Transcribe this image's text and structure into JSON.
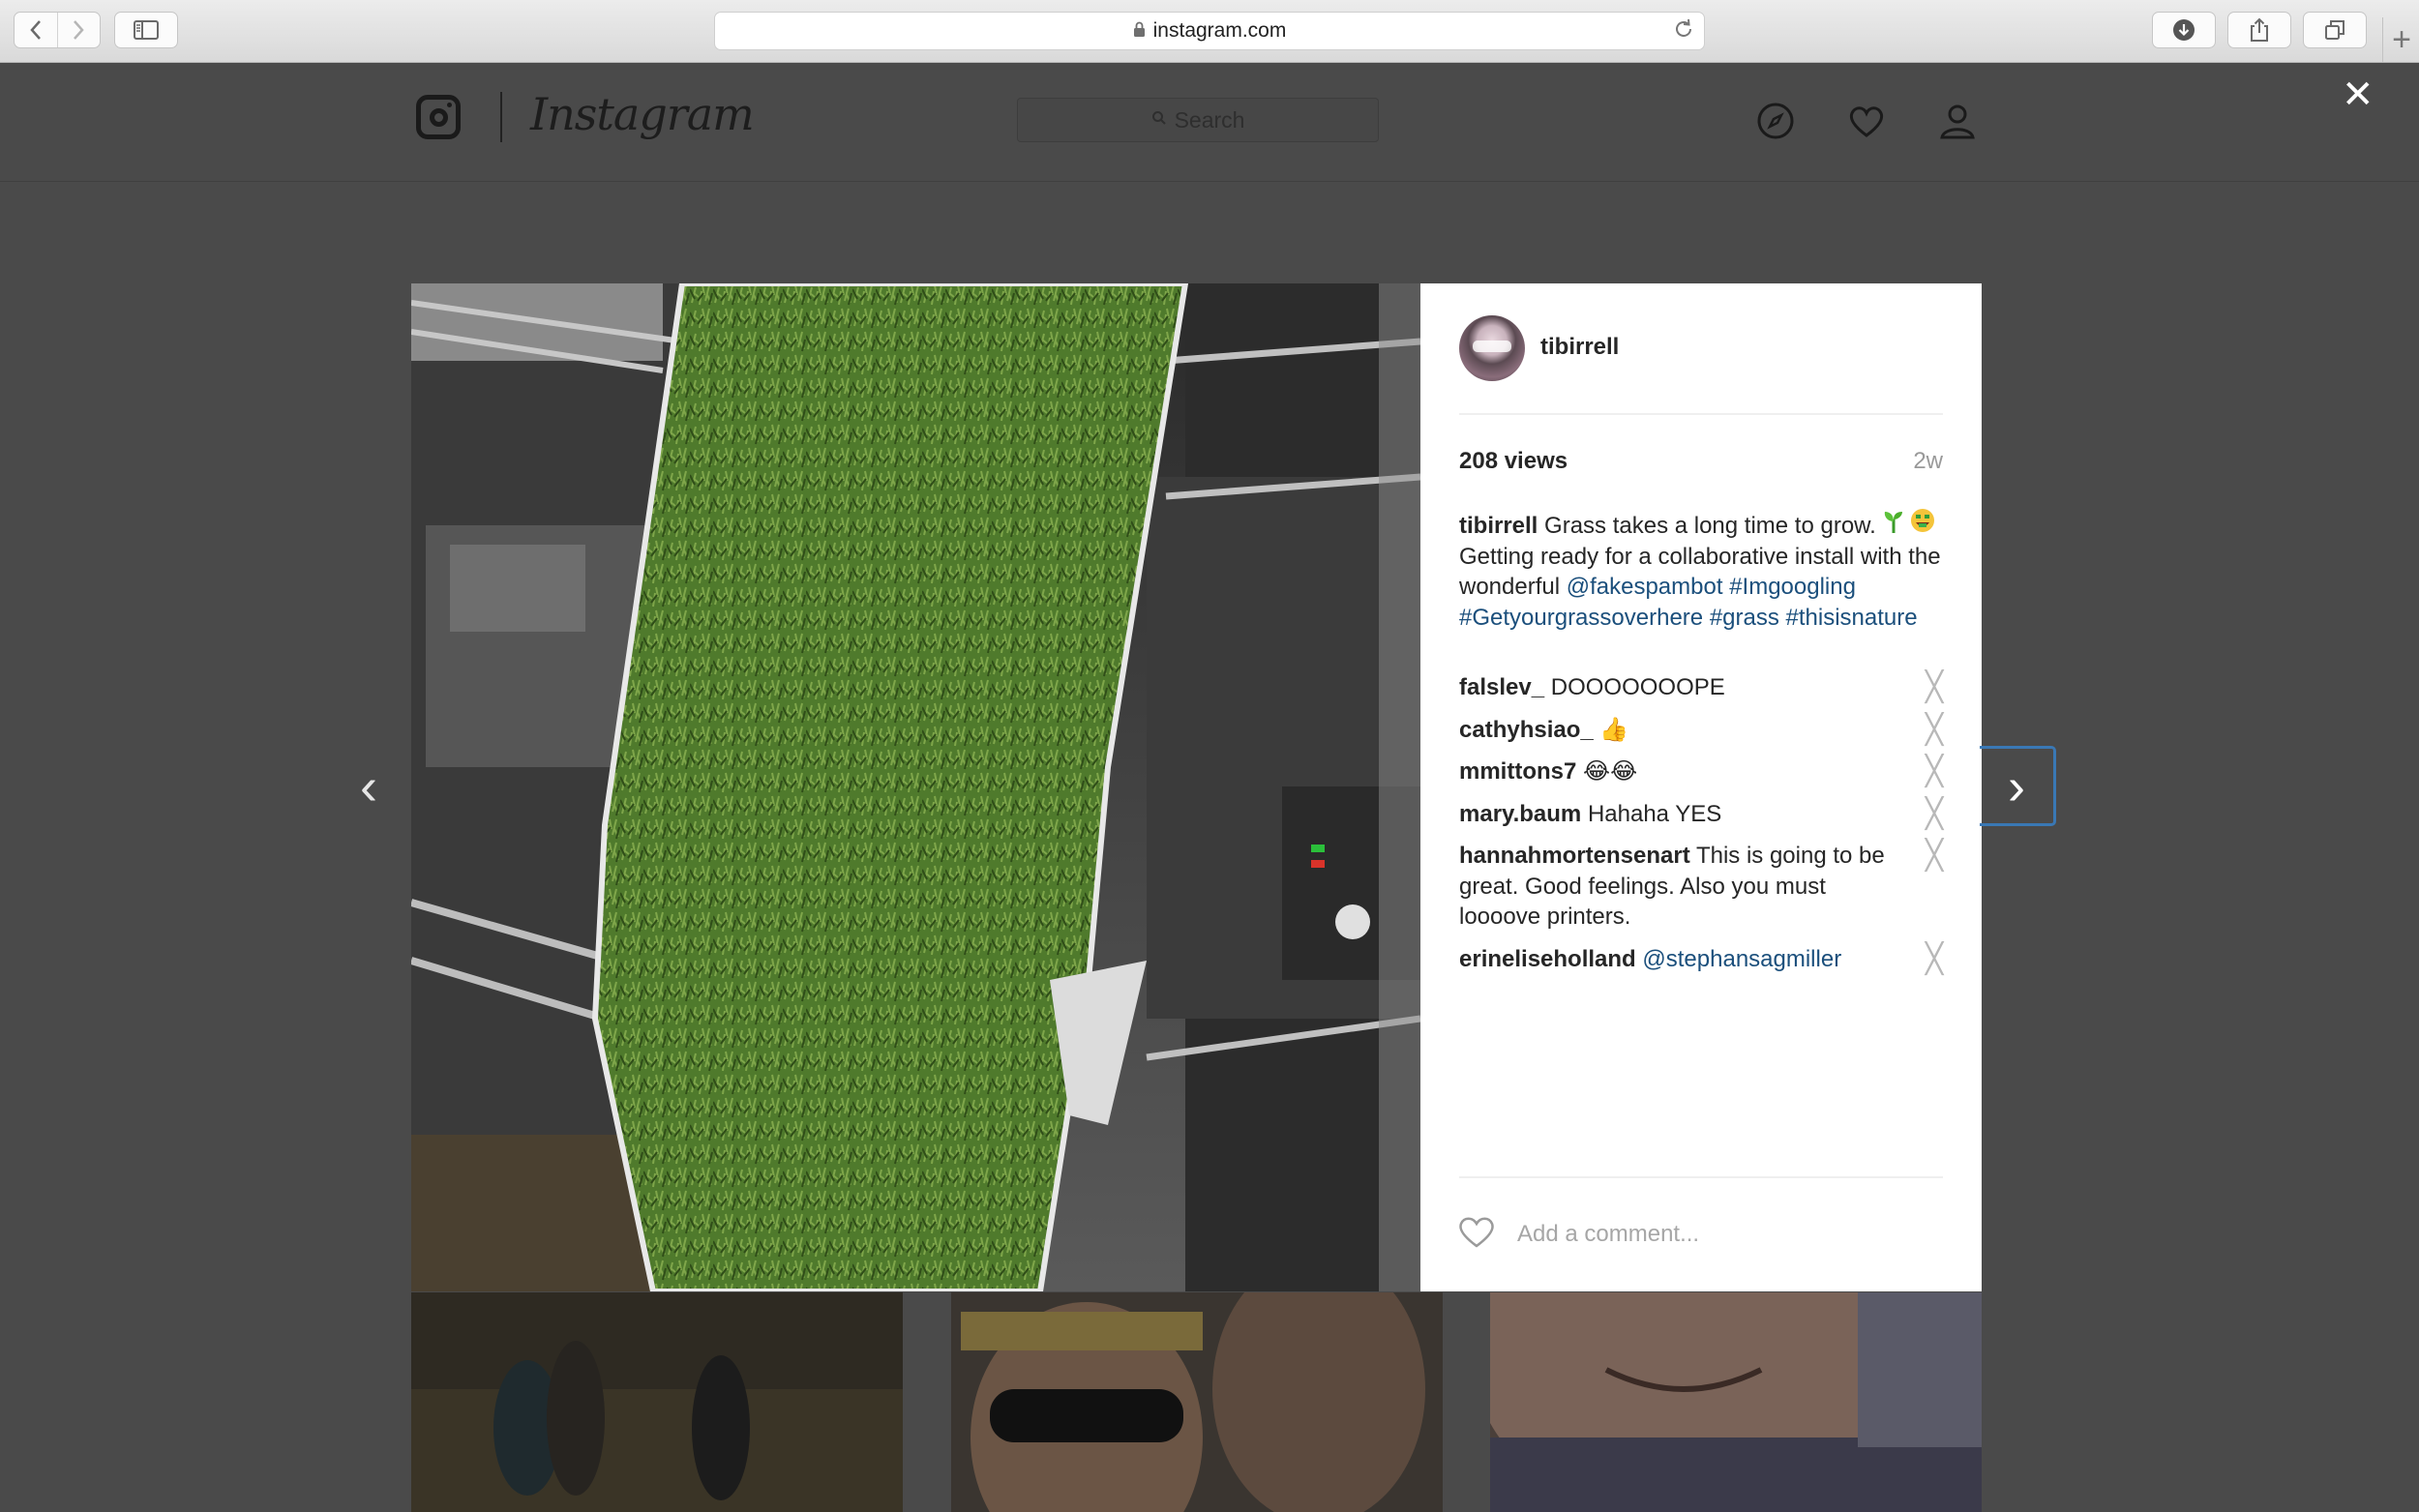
{
  "browser": {
    "url": "instagram.com",
    "icons": [
      "back-icon",
      "forward-icon",
      "sidebar-icon",
      "lock-icon",
      "reload-icon",
      "download-icon",
      "share-icon",
      "tabs-icon",
      "new-tab-icon"
    ]
  },
  "header": {
    "wordmark": "Instagram",
    "search_placeholder": "Search",
    "icons": [
      "instagram-logo-icon",
      "compass-icon",
      "heart-icon",
      "profile-icon"
    ],
    "close_label": "✕"
  },
  "post": {
    "author": "tibirrell",
    "views": "208 views",
    "age": "2w",
    "caption": {
      "author": "tibirrell",
      "text_1": "Grass takes a long time to grow.",
      "text_2": "Getting ready for a collaborative install with the wonderful",
      "mention": "@fakespambot",
      "tags": [
        "#Imgoogling",
        "#Getyourgrassoverhere",
        "#grass",
        "#thisisnature"
      ]
    },
    "comments": [
      {
        "user": "falslev_",
        "text": "DOOOOOOOPE"
      },
      {
        "user": "cathyhsiao_",
        "text": "👍"
      },
      {
        "user": "mmittons7",
        "text": "😂😂"
      },
      {
        "user": "mary.baum",
        "text": "Hahaha YES"
      },
      {
        "user": "hannahmortensenart",
        "text": "This is going to be great. Good feelings. Also you must loooove printers."
      },
      {
        "user": "erineliseholland",
        "text": "@stephansagmiller"
      }
    ],
    "comment_placeholder": "Add a comment...",
    "delete_glyph": "╳",
    "nav_prev": "‹",
    "nav_next": "›"
  },
  "colors": {
    "link": "#1b4f7c",
    "overlay_bg": "#4a4a4a",
    "focus_ring": "#3a78b5"
  }
}
